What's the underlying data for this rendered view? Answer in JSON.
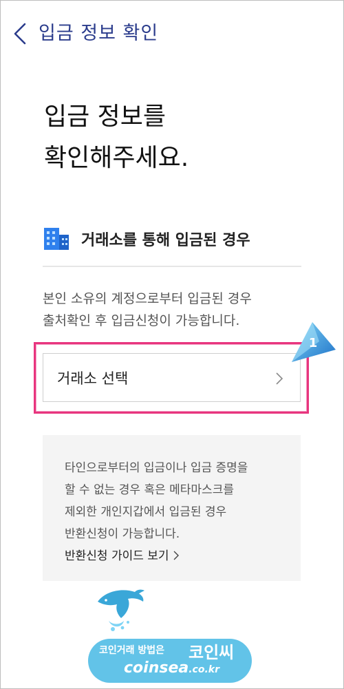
{
  "header": {
    "title": "입금 정보 확인"
  },
  "heading": "입금 정보를\n확인해주세요.",
  "section": {
    "title": "거래소를 통해 입금된 경우",
    "icon": "building-icon"
  },
  "description": "본인 소유의 계정으로부터 입금된 경우\n출처확인 후 입금신청이 가능합니다.",
  "exchange_select": {
    "label": "거래소 선택"
  },
  "callout": {
    "number": "1"
  },
  "info": {
    "text": "타인으로부터의 입금이나 입금 증명을\n할 수 없는 경우 혹은 메타마스크를\n제외한 개인지갑에서 입금된 경우\n반환신청이 가능합니다.",
    "link_label": "반환신청 가이드 보기"
  },
  "watermark": {
    "line1": "코인거래 방법은",
    "brand": "코인씨",
    "site": "coinsea",
    "domain": ".co.kr"
  },
  "colors": {
    "accent": "#2b3c8c",
    "highlight": "#e8357e",
    "watermark": "#62c3e8"
  }
}
